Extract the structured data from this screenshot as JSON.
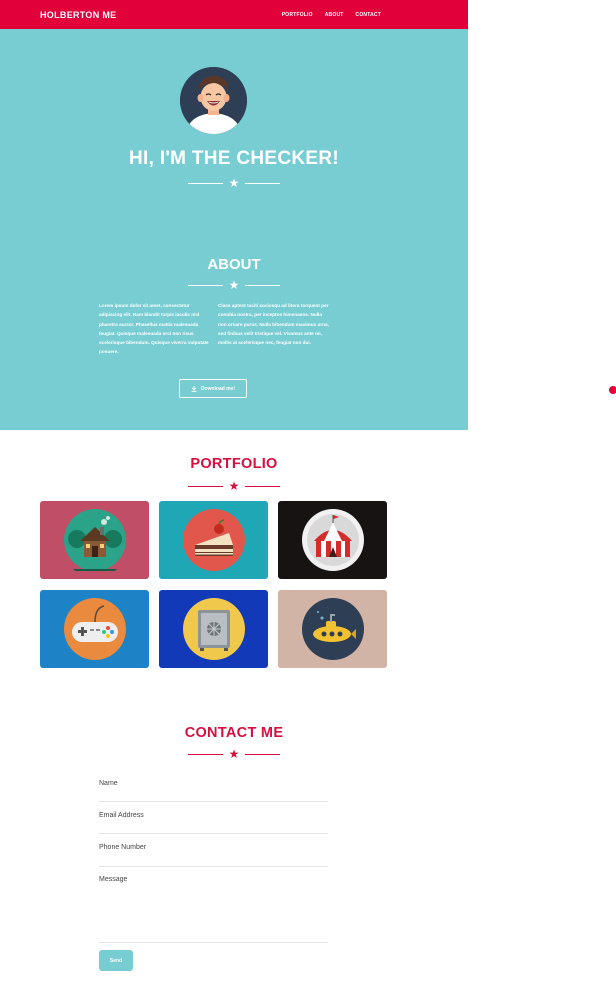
{
  "nav": {
    "brand": "HOLBERTON ME",
    "links": [
      "PORTFOLIO",
      "ABOUT",
      "CONTACT"
    ]
  },
  "hero": {
    "title": "HI, I'M THE CHECKER!"
  },
  "about": {
    "title": "ABOUT",
    "col_left": "Lorem ipsum dolor sit amet, consectetur adipiscing elit. Nam blandit turpis iaculis nisl pharetra auctor. Phasellus mattis malesuada feugiat. Quisque malesuada orci non risus scelerisque bibendum. Quisque viverra vulputate posuere.",
    "col_right": "Class aptent taciti sociosqu ad litora torquent per conubia nostra, per inceptos himenaeos. Nulla non ornare purus. Nulla bibendum maximus urna, sed finibus velit tristique vel. Vivamus ante mi, mollis at scelerisque nec, feugiat non dui.",
    "download_label": "Download me!"
  },
  "portfolio": {
    "title": "PORTFOLIO",
    "items": [
      {
        "icon": "cabin-icon",
        "bg": "#c04e66"
      },
      {
        "icon": "cake-icon",
        "bg": "#20a7b5"
      },
      {
        "icon": "circus-tent-icon",
        "bg": "#171313"
      },
      {
        "icon": "game-controller-icon",
        "bg": "#1e82c6"
      },
      {
        "icon": "safe-icon",
        "bg": "#1239b8"
      },
      {
        "icon": "submarine-icon",
        "bg": "#d2b4a6"
      }
    ]
  },
  "contact": {
    "title": "CONTACT ME",
    "fields": {
      "name": "Name",
      "email": "Email Address",
      "phone": "Phone Number",
      "message": "Message"
    },
    "send_label": "Send"
  },
  "colors": {
    "accent": "#e2003b",
    "teal": "#78cdd3"
  }
}
